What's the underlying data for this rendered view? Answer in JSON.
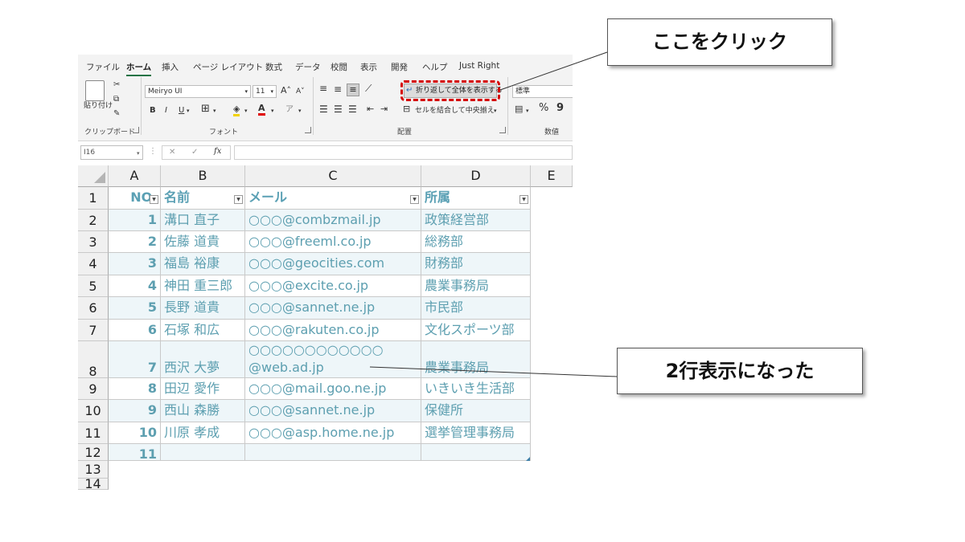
{
  "ribbon": {
    "tabs": [
      "ファイル",
      "ホーム",
      "挿入",
      "ページ レイアウト",
      "数式",
      "データ",
      "校閲",
      "表示",
      "開発",
      "ヘルプ",
      "Just Right"
    ],
    "clipboard": {
      "paste_label": "貼り付け",
      "group_label": "クリップボード"
    },
    "font": {
      "name": "Meiryo UI",
      "size": "11",
      "grow_label": "A",
      "shrink_label": "A",
      "bold": "B",
      "italic": "I",
      "underline": "U",
      "group_label": "フォント"
    },
    "alignment": {
      "wrap_text_label": "折り返して全体を表示する",
      "merge_center_label": "セルを結合して中央揃え",
      "group_label": "配置"
    },
    "number": {
      "format_value": "標準",
      "percent": "%",
      "comma": "9",
      "group_label": "数値"
    }
  },
  "formula_bar": {
    "name_box": "I16",
    "fx_label": "fx",
    "value": ""
  },
  "columns": [
    "A",
    "B",
    "C",
    "D",
    "E"
  ],
  "rows": [
    {
      "num": "1",
      "a": "NO.",
      "b": "名前",
      "c": "メール",
      "d": "所属"
    },
    {
      "num": "2",
      "a": "1",
      "b": "溝口 直子",
      "c": "○○○@combzmail.jp",
      "d": "政策経営部"
    },
    {
      "num": "3",
      "a": "2",
      "b": "佐藤 道貴",
      "c": "○○○@freeml.co.jp",
      "d": "総務部"
    },
    {
      "num": "4",
      "a": "3",
      "b": "福島 裕康",
      "c": "○○○@geocities.com",
      "d": "財務部"
    },
    {
      "num": "5",
      "a": "4",
      "b": "神田 重三郎",
      "c": "○○○@excite.co.jp",
      "d": "農業事務局"
    },
    {
      "num": "6",
      "a": "5",
      "b": "長野 道貴",
      "c": "○○○@sannet.ne.jp",
      "d": "市民部"
    },
    {
      "num": "7",
      "a": "6",
      "b": "石塚 和広",
      "c": "○○○@rakuten.co.jp",
      "d": "文化スポーツ部"
    },
    {
      "num": "8",
      "a": "7",
      "b": "西沢 大夢",
      "c1": "○○○○○○○○○○○○",
      "c2": "@web.ad.jp",
      "d": "農業事務局"
    },
    {
      "num": "9",
      "a": "8",
      "b": "田辺 愛作",
      "c": "○○○@mail.goo.ne.jp",
      "d": "いきいき生活部"
    },
    {
      "num": "10",
      "a": "9",
      "b": "西山 森勝",
      "c": "○○○@sannet.ne.jp",
      "d": "保健所"
    },
    {
      "num": "11",
      "a": "10",
      "b": "川原 孝成",
      "c": "○○○@asp.home.ne.jp",
      "d": "選挙管理事務局"
    },
    {
      "num": "12",
      "a": "11",
      "b": "",
      "c": "",
      "d": ""
    },
    {
      "num": "13"
    },
    {
      "num": "14"
    }
  ],
  "callouts": {
    "click_here": "ここをクリック",
    "two_lines": "2行表示になった"
  },
  "colors": {
    "accent_green": "#217346",
    "highlight_red": "#d40000",
    "data_text": "#5d9fb0",
    "band": "#eef6f9"
  }
}
